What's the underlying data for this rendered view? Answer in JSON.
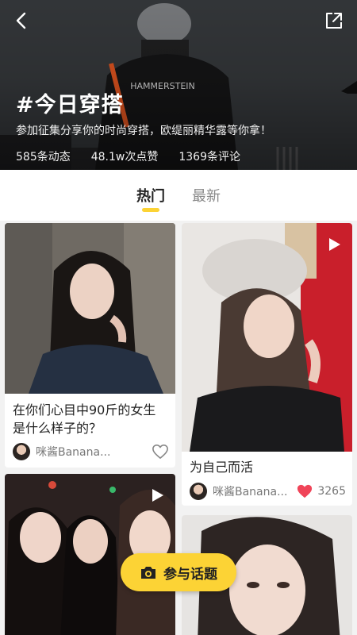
{
  "header": {
    "title": "#今日穿搭",
    "description": "参加征集分享你的时尚穿搭，欧缇丽精华露等你拿！",
    "stats": {
      "posts": "585条动态",
      "likes": "48.1w次点赞",
      "comments": "1369条评论"
    }
  },
  "tabs": [
    {
      "label": "热门",
      "active": true
    },
    {
      "label": "最新",
      "active": false
    }
  ],
  "feed": {
    "cards": [
      {
        "title_line1": "在你们心目中90斤的女生",
        "title_line2": "是什么样子的？",
        "author": "咪酱Banana...",
        "liked": false,
        "like_count": ""
      },
      {
        "title_line1": "为自己而活",
        "title_line2": "",
        "author": "咪酱Banana...",
        "liked": true,
        "like_count": "3265"
      },
      {
        "title_line1": "",
        "title_line2": "",
        "author": "",
        "liked": false,
        "like_count": ""
      },
      {
        "title_line1": "",
        "title_line2": "",
        "author": "",
        "liked": false,
        "like_count": ""
      }
    ]
  },
  "action": {
    "join_label": "参与话题"
  },
  "icons": {
    "back": "chevron-left-icon",
    "share": "share-external-icon",
    "like_empty": "heart-outline-icon",
    "like_filled": "heart-filled-icon",
    "video": "play-icon",
    "camera": "camera-icon"
  },
  "colors": {
    "accent": "#fcd335",
    "like_red": "#f04458",
    "text_primary": "#222222",
    "text_secondary": "#777777"
  }
}
